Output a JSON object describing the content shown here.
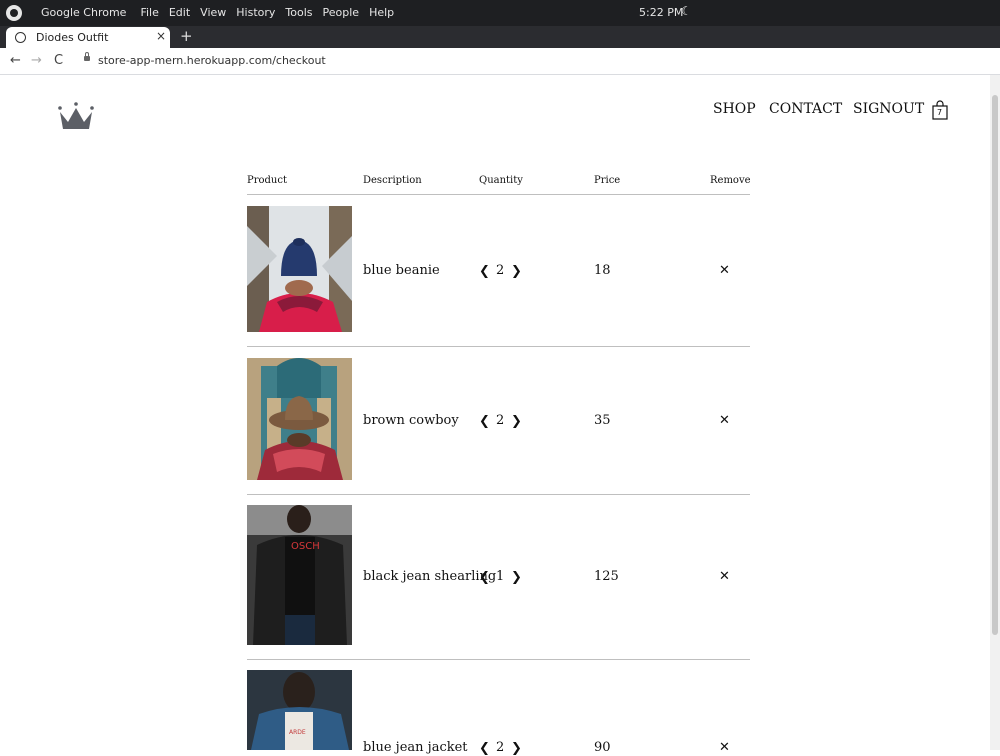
{
  "os": {
    "app_name": "Google Chrome",
    "menu": [
      "File",
      "Edit",
      "View",
      "History",
      "Tools",
      "People",
      "Help"
    ],
    "clock": "5:22 PM"
  },
  "browser": {
    "tab_title": "Diodes Outfit",
    "tab_close": "×",
    "new_tab": "+",
    "back": "←",
    "forward": "→",
    "reload": "C",
    "url": "store-app-mern.herokuapp.com/checkout"
  },
  "site": {
    "nav": {
      "shop": "SHOP",
      "contact": "CONTACT",
      "signout": "SIGNOUT"
    },
    "cart_count": "7"
  },
  "checkout": {
    "headers": {
      "product": "Product",
      "description": "Description",
      "quantity": "Quantity",
      "price": "Price",
      "remove": "Remove"
    },
    "decrease_symbol": "❮",
    "increase_symbol": "❯",
    "remove_symbol": "✕",
    "items": [
      {
        "description": "blue beanie",
        "quantity": "2",
        "price": "18"
      },
      {
        "description": "brown cowboy",
        "quantity": "2",
        "price": "35"
      },
      {
        "description": "black jean shearling",
        "quantity": "1",
        "price": "125"
      },
      {
        "description": "blue jean jacket",
        "quantity": "2",
        "price": "90"
      }
    ]
  },
  "colors": {
    "os_bar": "#1e1f22",
    "tab_strip": "#2b2c30",
    "rule": "#bfbfbf",
    "crown": "#5c5f66"
  }
}
